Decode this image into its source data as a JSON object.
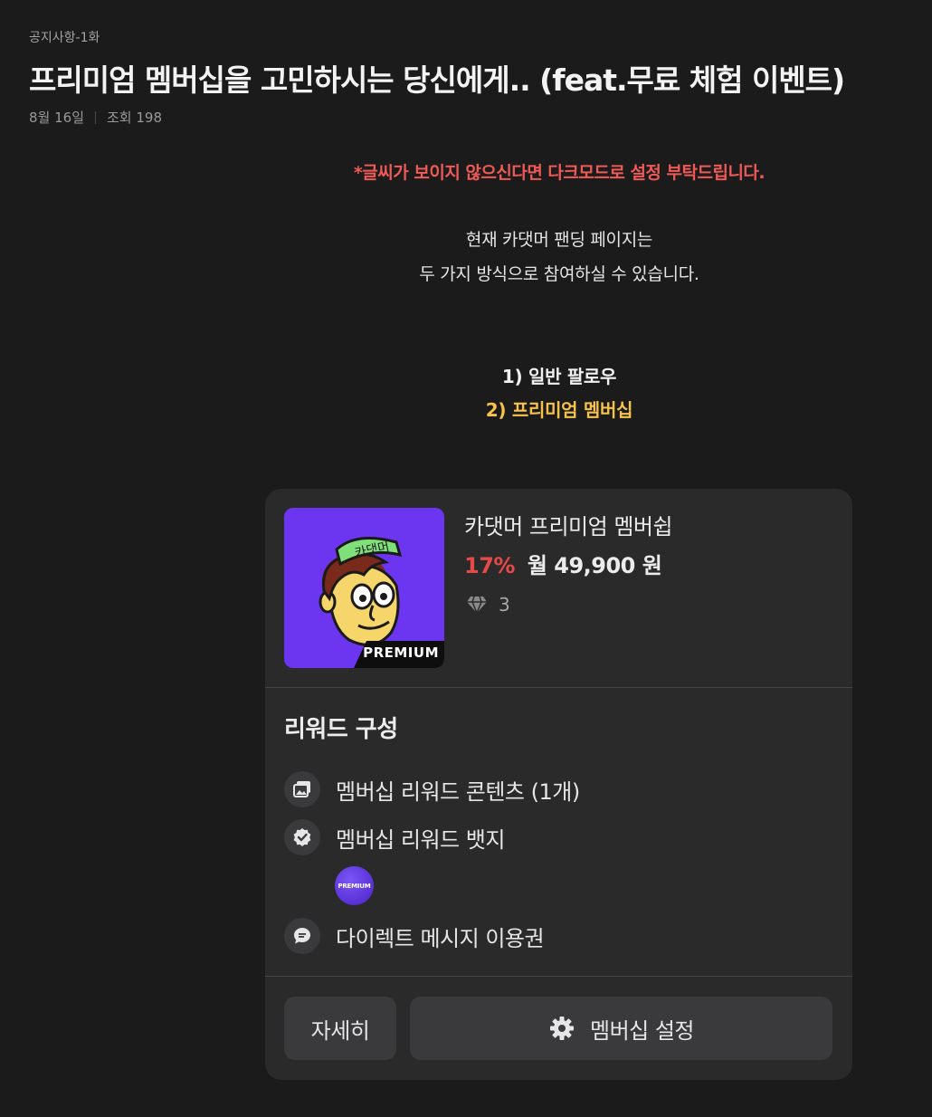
{
  "post": {
    "category": "공지사항-1화",
    "title": "프리미엄 멤버십을 고민하시는 당신에게.. (feat.무료 체험 이벤트)",
    "date": "8월 16일",
    "views": "조회 198"
  },
  "body": {
    "notice": "*글씨가 보이지 않으신다면 다크모드로 설정 부탁드립니다.",
    "intro_line1": "현재 카댓머 팬딩 페이지는",
    "intro_line2": "두 가지 방식으로 참여하실 수 있습니다.",
    "option1": "1) 일반 팔로우",
    "option2": "2) 프리미엄 멤버십"
  },
  "membership": {
    "thumbnail_text": "카댓머",
    "banner_text": "PREMIUM",
    "name": "카댓머 프리미엄 멤버쉽",
    "discount": "17%",
    "price": "월 49,900 원",
    "gem_count": "3",
    "rewards_title": "리워드 구성",
    "rewards": [
      {
        "label": "멤버십 리워드 콘텐츠 (1개)",
        "icon": "gallery-icon"
      },
      {
        "label": "멤버십 리워드 뱃지",
        "icon": "verified-check-icon"
      },
      {
        "label": "다이렉트 메시지 이용권",
        "icon": "chat-bubble-icon"
      }
    ],
    "badge_text": "PREMIUM",
    "detail_button": "자세히",
    "settings_button": "멤버십 설정"
  },
  "colors": {
    "background": "#1b1b1c",
    "card": "#2a2a2b",
    "notice": "#ef5a57",
    "highlight": "#f7c24c",
    "discount": "#e64a48",
    "thumbnail": "#6c36f0"
  }
}
